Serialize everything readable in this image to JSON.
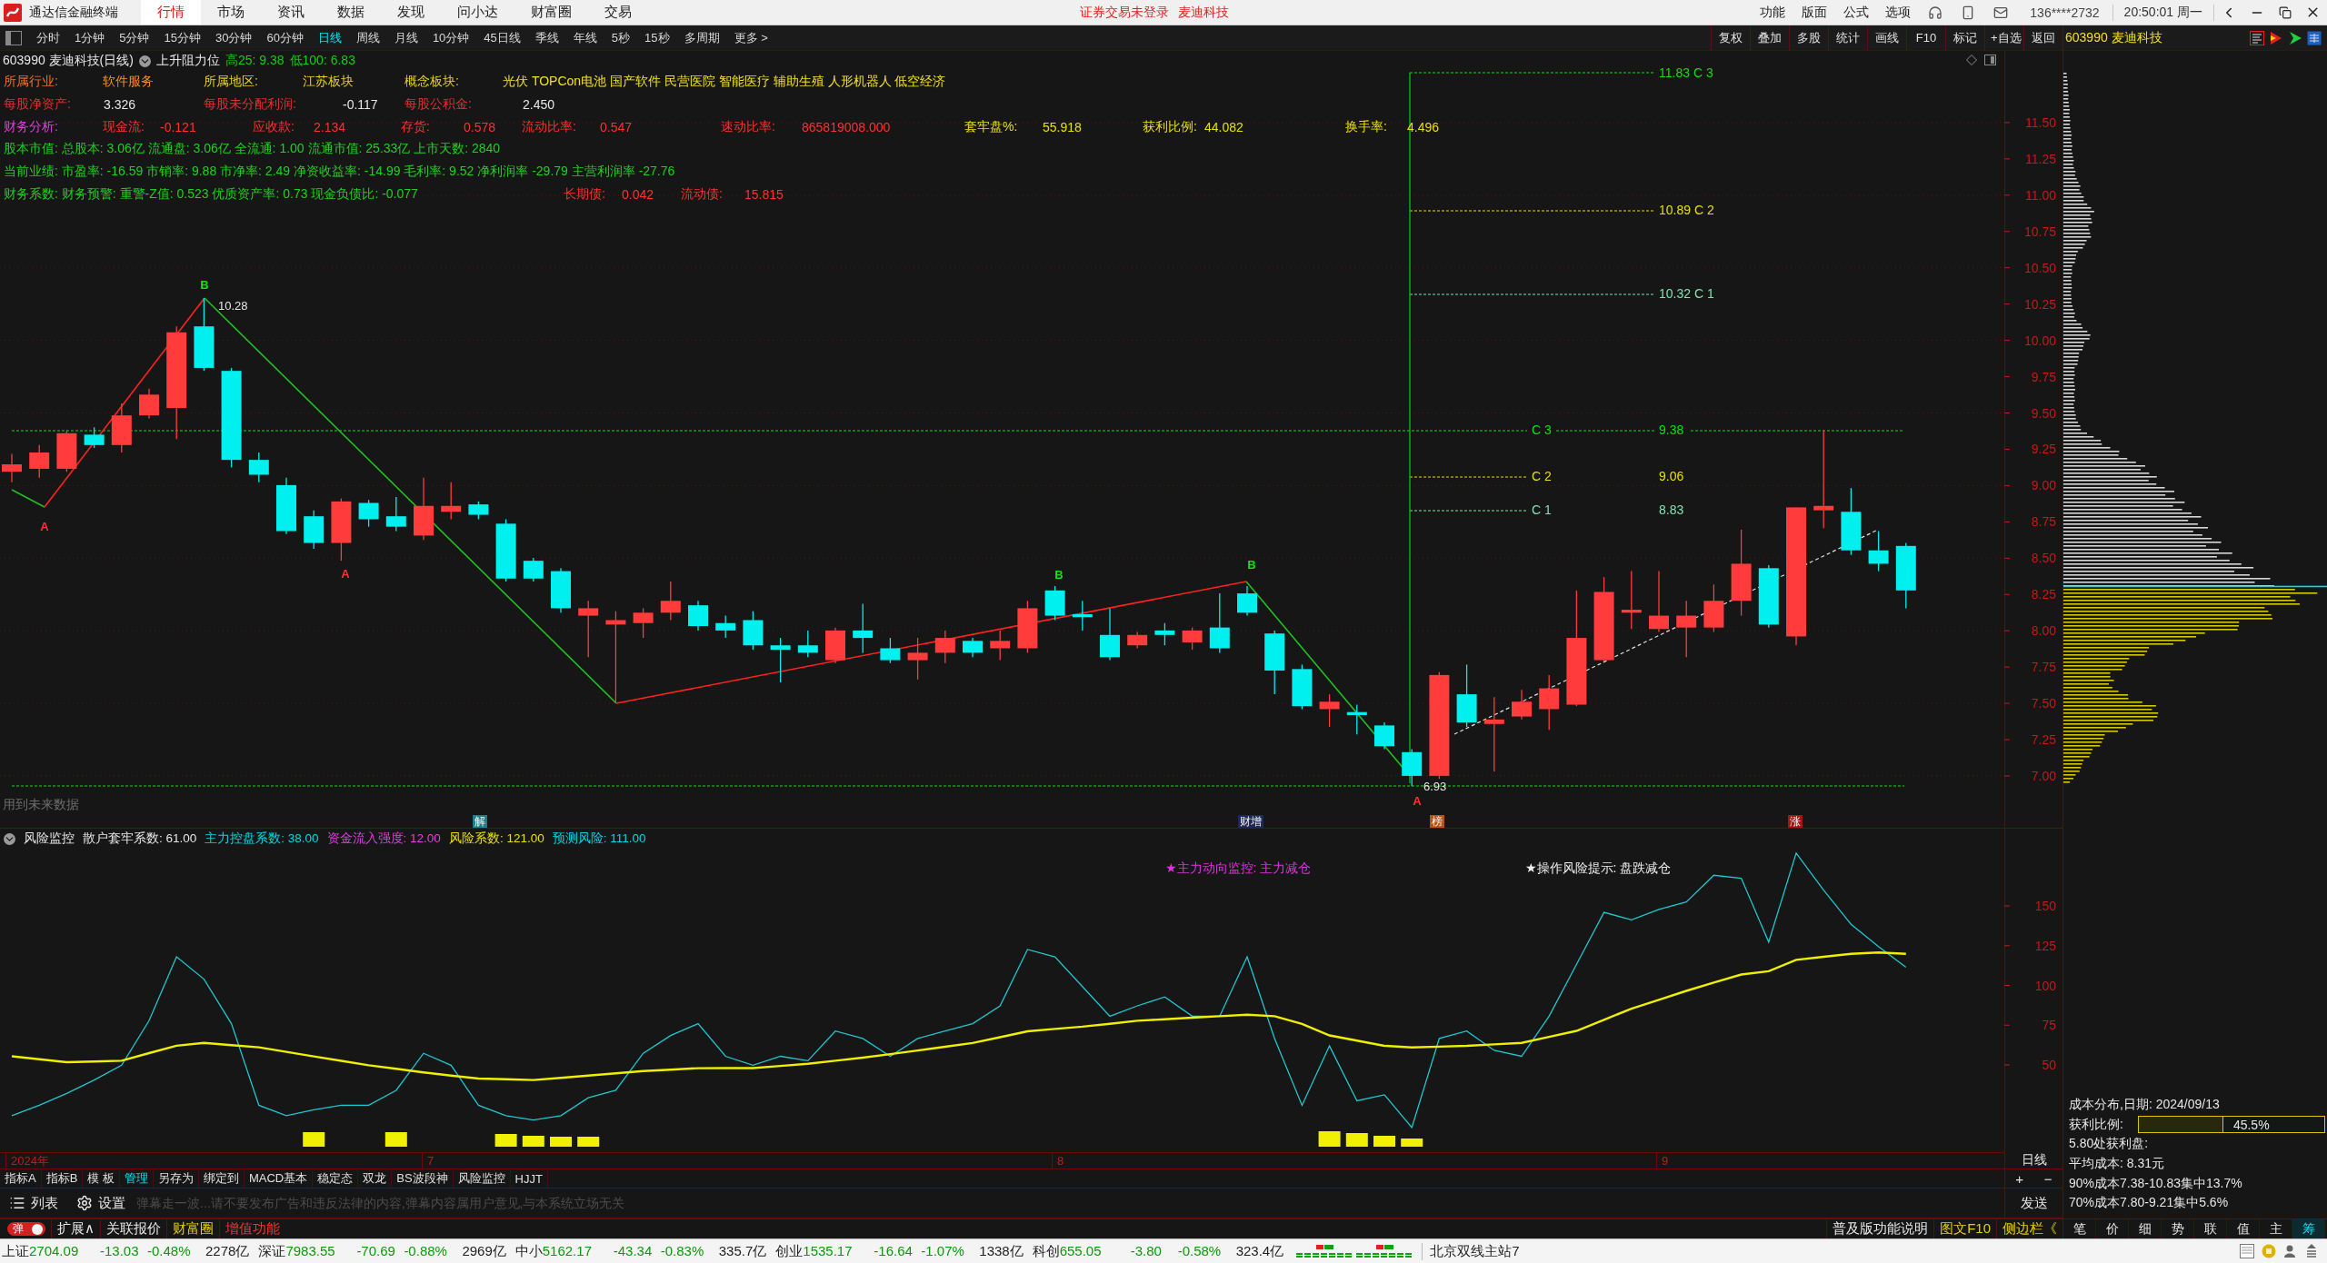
{
  "window": {
    "app_name": "通达信金融终端",
    "menu": [
      {
        "label": "行情",
        "selected": true
      },
      {
        "label": "市场",
        "selected": false
      },
      {
        "label": "资讯",
        "selected": false
      },
      {
        "label": "数据",
        "selected": false
      },
      {
        "label": "发现",
        "selected": false
      },
      {
        "label": "问小达",
        "selected": false
      },
      {
        "label": "财富圈",
        "selected": false
      },
      {
        "label": "交易",
        "selected": false
      }
    ],
    "notice": "证券交易未登录",
    "notice_stock": "麦迪科技",
    "actions": [
      "功能",
      "版面",
      "公式",
      "选项"
    ],
    "account": "136****2732",
    "clock": "20:50:01 周一"
  },
  "toolbar": {
    "periods": [
      {
        "label": "分时",
        "selected": false
      },
      {
        "label": "1分钟",
        "selected": false
      },
      {
        "label": "5分钟",
        "selected": false
      },
      {
        "label": "15分钟",
        "selected": false
      },
      {
        "label": "30分钟",
        "selected": false
      },
      {
        "label": "60分钟",
        "selected": false
      },
      {
        "label": "日线",
        "selected": true
      },
      {
        "label": "周线",
        "selected": false
      },
      {
        "label": "月线",
        "selected": false
      },
      {
        "label": "10分钟",
        "selected": false
      },
      {
        "label": "45日线",
        "selected": false
      },
      {
        "label": "季线",
        "selected": false
      },
      {
        "label": "年线",
        "selected": false
      },
      {
        "label": "5秒",
        "selected": false
      },
      {
        "label": "15秒",
        "selected": false
      },
      {
        "label": "多周期",
        "selected": false
      },
      {
        "label": "更多 >",
        "selected": false
      }
    ],
    "tools": [
      "复权",
      "叠加",
      "多股",
      "统计",
      "画线",
      "F10",
      "标记",
      "+自选",
      "返回"
    ]
  },
  "chart": {
    "title": "603990 麦迪科技(日线)",
    "study": "上升阻力位",
    "readings": [
      "高25: 9.38",
      "低100: 6.83"
    ],
    "info_lines": [
      {
        "segments": [
          {
            "text": "所属行业:",
            "color": "#f07028"
          },
          {
            "text": "软件服务",
            "color": "#f09028"
          },
          {
            "text": "所属地区:",
            "color": "#e8d020"
          },
          {
            "text": "江苏板块",
            "color": "#e8d020"
          },
          {
            "text": "概念板块:",
            "color": "#e8d020"
          },
          {
            "text": "光伏 TOPCon电池 国产软件 民营医院 智能医疗 辅助生殖 人形机器人 低空经济",
            "color": "#f0e020"
          }
        ]
      },
      {
        "segments": [
          {
            "text": "每股净资产:",
            "color": "#e03030"
          },
          {
            "text": "3.326",
            "color": "#e6e6e6"
          },
          {
            "text": "每股未分配利润:",
            "color": "#e03030"
          },
          {
            "text": "-0.117",
            "color": "#e6e6e6"
          },
          {
            "text": "每股公积金:",
            "color": "#e03030"
          },
          {
            "text": "2.450",
            "color": "#e6e6e6"
          }
        ]
      },
      {
        "segments": [
          {
            "text": "财务分析:",
            "color": "#e040e0"
          },
          {
            "text": "现金流:",
            "color": "#ff3030"
          },
          {
            "text": "-0.121",
            "color": "#ff3030"
          },
          {
            "text": "应收款:",
            "color": "#ff3030"
          },
          {
            "text": "2.134",
            "color": "#ff3030"
          },
          {
            "text": "存货:",
            "color": "#ff3030"
          },
          {
            "text": "0.578",
            "color": "#ff3030"
          },
          {
            "text": "流动比率:",
            "color": "#ff3030"
          },
          {
            "text": "0.547",
            "color": "#ff3030"
          },
          {
            "text": "速动比率:",
            "color": "#ff3030"
          },
          {
            "text": "865819008.000",
            "color": "#ff3030"
          },
          {
            "text": "套牢盘%:",
            "color": "#e8e000"
          },
          {
            "text": "55.918",
            "color": "#e8e000"
          },
          {
            "text": "获利比例:",
            "color": "#e8e000"
          },
          {
            "text": "44.082",
            "color": "#e8e000"
          },
          {
            "text": "换手率:",
            "color": "#e8e000"
          },
          {
            "text": "4.496",
            "color": "#e8e000"
          }
        ]
      },
      {
        "segments": [
          {
            "text": "股本市值: 总股本: 3.06亿 流通盘: 3.06亿 全流通: 1.00 流通市值: 25.33亿 上市天数: 2840",
            "color": "#20d020"
          }
        ]
      },
      {
        "segments": [
          {
            "text": "当前业绩: 市盈率: -16.59 市销率: 9.88 市净率: 2.49 净资收益率: -14.99 毛利率: 9.52 净利润率 -29.79 主营利润率 -27.76",
            "color": "#20d020"
          }
        ]
      },
      {
        "segments": [
          {
            "text": "财务系数: 财务预警: 重警-Z值: 0.523 优质资产率: 0.73 现金负债比: -0.077",
            "color": "#20d020"
          },
          {
            "text": "长期债:",
            "color": "#ff3030"
          },
          {
            "text": "0.042",
            "color": "#ff3030"
          },
          {
            "text": "流动债:",
            "color": "#ff3030"
          },
          {
            "text": "15.815",
            "color": "#ff3030"
          }
        ]
      }
    ],
    "price_axis": [
      "11.50",
      "11.25",
      "11.00",
      "10.75",
      "10.50",
      "10.25",
      "10.00",
      "9.75",
      "9.50",
      "9.25",
      "9.00",
      "8.75",
      "8.50",
      "8.25",
      "8.00",
      "7.75",
      "7.50",
      "7.25",
      "7.00"
    ],
    "marks": [
      {
        "text": "B",
        "kind": "high"
      },
      {
        "text": "10.28",
        "kind": "price"
      },
      {
        "text": "A",
        "kind": "low"
      },
      {
        "text": "A",
        "kind": "low"
      },
      {
        "text": "B",
        "kind": "high"
      },
      {
        "text": "B",
        "kind": "high"
      },
      {
        "text": "A",
        "kind": "low"
      },
      {
        "text": "6.93",
        "kind": "price"
      }
    ],
    "levels": [
      {
        "text": "11.83 C 3",
        "color": "#10e010"
      },
      {
        "text": "10.89 C 2",
        "color": "#e8e000"
      },
      {
        "text": "10.32 C 1",
        "color": "#80e0b0"
      },
      {
        "text": "C 3",
        "color": "#10e010"
      },
      {
        "text": "9.38",
        "color": "#10e010"
      },
      {
        "text": "C 2",
        "color": "#e8e000"
      },
      {
        "text": "9.06",
        "color": "#e8e000"
      },
      {
        "text": "C 1",
        "color": "#80e0b0"
      },
      {
        "text": "8.83",
        "color": "#80e0b0"
      }
    ],
    "note": "用到未来数据",
    "events": [
      {
        "text": "解",
        "color": "#1e7e8c"
      },
      {
        "text": "财增",
        "color": "#1c2a55"
      },
      {
        "text": "榜",
        "color": "#b5541a"
      },
      {
        "text": "涨",
        "color": "#a81414"
      }
    ]
  },
  "indicator": {
    "name": "风险监控",
    "readings": [
      {
        "text": "散户套牢系数: 61.00",
        "color": "#e6e6e6"
      },
      {
        "text": "主力控盘系数: 38.00",
        "color": "#00d8e8"
      },
      {
        "text": "资金流入强度: 12.00",
        "color": "#e040e0"
      },
      {
        "text": "风险系数: 121.00",
        "color": "#e8e000"
      },
      {
        "text": "预测风险: 111.00",
        "color": "#00d8e8"
      }
    ],
    "alerts": [
      {
        "text": "★主力动向监控: 主力减仓",
        "color": "#e030e0"
      },
      {
        "text": "★操作风险提示: 盘跌减仓",
        "color": "#f0f0f0"
      }
    ],
    "axis": [
      "150",
      "125",
      "100",
      "75",
      "50"
    ]
  },
  "date_axis": [
    "2024年",
    "7",
    "8",
    "9"
  ],
  "period_label": "日线",
  "zoom_buttons": [
    "+",
    "−"
  ],
  "indicator_tabs": [
    {
      "label": "指标A",
      "selected": false
    },
    {
      "label": "指标B",
      "selected": false
    },
    {
      "label": "模 板",
      "selected": false
    },
    {
      "label": "管理",
      "selected": true
    },
    {
      "label": "另存为",
      "selected": false
    },
    {
      "label": "绑定到",
      "selected": false
    },
    {
      "label": "MACD基本",
      "selected": false
    },
    {
      "label": "稳定态",
      "selected": false
    },
    {
      "label": "双龙",
      "selected": false
    },
    {
      "label": "BS波段神",
      "selected": false
    },
    {
      "label": "风险监控",
      "selected": false
    },
    {
      "label": "HJJT",
      "selected": false
    }
  ],
  "danmu": {
    "actions": [
      "列表",
      "设置"
    ],
    "placeholder": "弹幕走一波...请不要发布广告和违反法律的内容,弹幕内容属用户意见,与本系统立场无关",
    "send": "发送"
  },
  "bottom_bar": {
    "toggle": {
      "label": "弹",
      "on": true
    },
    "links": [
      {
        "text": "扩展∧",
        "kind": "plain"
      },
      {
        "text": "关联报价",
        "kind": "plain"
      },
      {
        "text": "财富圈",
        "kind": "featured"
      },
      {
        "text": "增值功能",
        "kind": "promo"
      }
    ],
    "help": "普及版功能说明",
    "extras": [
      {
        "text": "图文F10",
        "kind": "featured"
      },
      {
        "text": "侧边栏《",
        "kind": "featured"
      }
    ],
    "side_tabs": [
      {
        "label": "笔",
        "selected": false
      },
      {
        "label": "价",
        "selected": false
      },
      {
        "label": "细",
        "selected": false
      },
      {
        "label": "势",
        "selected": false
      },
      {
        "label": "联",
        "selected": false
      },
      {
        "label": "值",
        "selected": false
      },
      {
        "label": "主",
        "selected": false
      },
      {
        "label": "筹",
        "selected": true
      }
    ]
  },
  "side_panel": {
    "title": "603990 麦迪科技",
    "cost": {
      "heading": "成本分布,日期: 2024/09/13",
      "profit_label": "获利比例:",
      "profit": {
        "level": 0.455,
        "reading": "45.5%"
      },
      "lines": [
        "5.80处获利盘:",
        "平均成本: 8.31元",
        "90%成本7.38-10.83集中13.7%",
        "70%成本7.80-9.21集中5.6%"
      ]
    }
  },
  "status_bar": {
    "indices": [
      {
        "name": "上证",
        "value": "2704.09",
        "change": "-13.03",
        "percent": "-0.48%",
        "amount": "2278亿",
        "falling": true
      },
      {
        "name": "深证",
        "value": "7983.55",
        "change": "-70.69",
        "percent": "-0.88%",
        "amount": "2969亿",
        "falling": true
      },
      {
        "name": "中小",
        "value": "5162.17",
        "change": "-43.34",
        "percent": "-0.83%",
        "amount": "335.7亿",
        "falling": true
      },
      {
        "name": "创业",
        "value": "1535.17",
        "change": "-16.64",
        "percent": "-1.07%",
        "amount": "1338亿",
        "falling": true
      },
      {
        "name": "科创",
        "value": "655.05",
        "change": "-3.80",
        "percent": "-0.58%",
        "amount": "323.4亿",
        "falling": true
      }
    ],
    "server": "北京双线主站7"
  }
}
